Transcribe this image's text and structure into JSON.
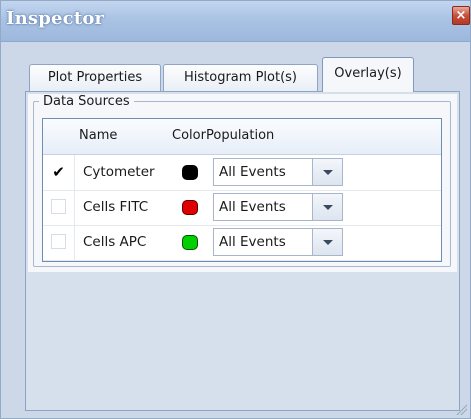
{
  "window": {
    "title": "Inspector",
    "close_glyph": "×"
  },
  "tabs": [
    {
      "label": "Plot Properties",
      "selected": false
    },
    {
      "label": "Histogram Plot(s)",
      "selected": false
    },
    {
      "label": "Overlay(s)",
      "selected": true
    }
  ],
  "data_sources": {
    "group_label": "Data Sources",
    "columns": {
      "name": "Name",
      "color": "Color",
      "population": "Population"
    },
    "rows": [
      {
        "checked": true,
        "check_glyph": "✔",
        "name": "Cytometer",
        "color": "#000000",
        "population": "All Events"
      },
      {
        "checked": false,
        "check_glyph": "",
        "name": "Cells FITC",
        "color": "#e00000",
        "population": "All Events"
      },
      {
        "checked": false,
        "check_glyph": "",
        "name": "Cells APC",
        "color": "#00d000",
        "population": "All Events"
      }
    ]
  },
  "colors": {
    "window_bg": "#ccd8e8",
    "title_bar": "#a6bfe2",
    "close_button": "#c7503c",
    "panel_bg": "#f5f7fa",
    "grid_border": "#6f8db3"
  },
  "icons": {
    "close": "close-icon",
    "dropdown": "chevron-down-icon",
    "resize": "resize-grip-icon"
  }
}
